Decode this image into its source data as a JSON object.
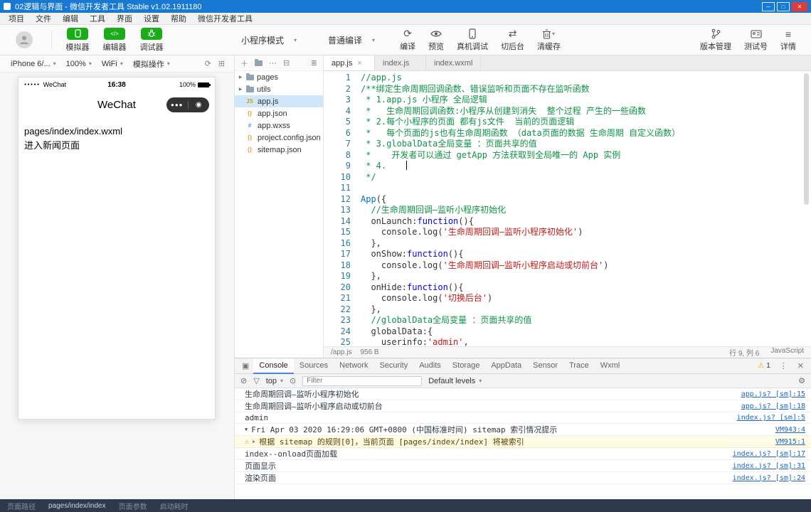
{
  "colors": {
    "title_blue": "#1879d2",
    "wechat_green": "#1aad19",
    "warning_bg": "#fffbe5",
    "link_blue": "#1a66c9",
    "comment_green": "#0e9347",
    "keyword_blue": "#0000ff",
    "string_red": "#c41a16"
  },
  "titlebar": {
    "title": "02逻辑与界面 - 微信开发者工具 Stable v1.02.1911180"
  },
  "menubar": {
    "items": [
      "项目",
      "文件",
      "编辑",
      "工具",
      "界面",
      "设置",
      "帮助",
      "微信开发者工具"
    ]
  },
  "toolbar": {
    "view_buttons": [
      {
        "label": "模拟器"
      },
      {
        "label": "编辑器"
      },
      {
        "label": "调试器"
      }
    ],
    "mode_select": {
      "value": "小程序模式"
    },
    "compile_select": {
      "value": "普通编译"
    },
    "actions": [
      {
        "label": "编译"
      },
      {
        "label": "预览"
      },
      {
        "label": "真机调试"
      },
      {
        "label": "切后台"
      },
      {
        "label": "清缓存"
      }
    ],
    "right_actions": [
      {
        "label": "版本管理"
      },
      {
        "label": "测试号"
      },
      {
        "label": "详情"
      }
    ]
  },
  "simulator": {
    "device_select": "iPhone 6/...",
    "zoom_select": "100%",
    "network_select": "WiFi",
    "operation_select": "模拟操作",
    "phone": {
      "carrier": "WeChat",
      "time": "16:38",
      "battery": "100%",
      "nav_title": "WeChat",
      "content": [
        "pages/index/index.wxml",
        "进入新闻页面"
      ]
    }
  },
  "explorer": {
    "files": [
      {
        "name": "pages",
        "kind": "folder"
      },
      {
        "name": "utils",
        "kind": "folder"
      },
      {
        "name": "app.js",
        "kind": "js",
        "selected": true
      },
      {
        "name": "app.json",
        "kind": "json"
      },
      {
        "name": "app.wxss",
        "kind": "wxss"
      },
      {
        "name": "project.config.json",
        "kind": "json"
      },
      {
        "name": "sitemap.json",
        "kind": "json"
      }
    ]
  },
  "editor": {
    "tabs": [
      {
        "label": "app.js",
        "active": true
      },
      {
        "label": "index.js",
        "active": false
      },
      {
        "label": "index.wxml",
        "active": false
      }
    ],
    "status": {
      "file": "/app.js",
      "size": "956 B",
      "cursor": "行 9, 列 6",
      "language": "JavaScript"
    },
    "code": [
      {
        "n": 1,
        "seg": [
          [
            "c",
            "//app.js"
          ]
        ]
      },
      {
        "n": 2,
        "seg": [
          [
            "c",
            "/**绑定生命周期回调函数、错误监听和页面不存在监听函数"
          ]
        ]
      },
      {
        "n": 3,
        "seg": [
          [
            "c",
            " * 1.app.js 小程序 全局逻辑"
          ]
        ]
      },
      {
        "n": 4,
        "seg": [
          [
            "c",
            " *   生命周期回调函数:小程序从创建到消失  整个过程 产生的一些函数"
          ]
        ]
      },
      {
        "n": 5,
        "seg": [
          [
            "c",
            " * 2.每个小程序的页面 都有js文件  当前的页面逻辑"
          ]
        ]
      },
      {
        "n": 6,
        "seg": [
          [
            "c",
            " *   每个页面的js也有生命周期函数 （data页面的数据 生命周期 自定义函数）"
          ]
        ]
      },
      {
        "n": 7,
        "seg": [
          [
            "c",
            " * 3.globalData全局变量 ：页面共享的值"
          ]
        ]
      },
      {
        "n": 8,
        "seg": [
          [
            "c",
            " *    开发者可以通过 getApp 方法获取到全局唯一的 App 实例"
          ]
        ]
      },
      {
        "n": 9,
        "seg": [
          [
            "c",
            " * 4."
          ]
        ],
        "cursor": true
      },
      {
        "n": 10,
        "seg": [
          [
            "c",
            " */"
          ]
        ]
      },
      {
        "n": 11,
        "seg": []
      },
      {
        "n": 12,
        "seg": [
          [
            "f",
            "App"
          ],
          [
            "p",
            "({"
          ]
        ]
      },
      {
        "n": 13,
        "seg": [
          [
            "c",
            "  //生命周期回调—监听小程序初始化"
          ]
        ]
      },
      {
        "n": 14,
        "seg": [
          [
            "p",
            "  onLaunch:"
          ],
          [
            "k",
            "function"
          ],
          [
            "p",
            "(){"
          ]
        ]
      },
      {
        "n": 15,
        "seg": [
          [
            "p",
            "    console.log("
          ],
          [
            "s",
            "'生命周期回调—监听小程序初始化'"
          ],
          [
            "p",
            ")"
          ]
        ]
      },
      {
        "n": 16,
        "seg": [
          [
            "p",
            "  },"
          ]
        ]
      },
      {
        "n": 17,
        "seg": [
          [
            "p",
            "  onShow:"
          ],
          [
            "k",
            "function"
          ],
          [
            "p",
            "(){"
          ]
        ]
      },
      {
        "n": 18,
        "seg": [
          [
            "p",
            "    console.log("
          ],
          [
            "s",
            "'生命周期回调—监听小程序启动或切前台'"
          ],
          [
            "p",
            ")"
          ]
        ]
      },
      {
        "n": 19,
        "seg": [
          [
            "p",
            "  },"
          ]
        ]
      },
      {
        "n": 20,
        "seg": [
          [
            "p",
            "  onHide:"
          ],
          [
            "k",
            "function"
          ],
          [
            "p",
            "(){"
          ]
        ]
      },
      {
        "n": 21,
        "seg": [
          [
            "p",
            "    console.log("
          ],
          [
            "s",
            "'切换后台'"
          ],
          [
            "p",
            ")"
          ]
        ]
      },
      {
        "n": 22,
        "seg": [
          [
            "p",
            "  },"
          ]
        ]
      },
      {
        "n": 23,
        "seg": [
          [
            "c",
            "  //globalData全局变量 ：页面共享的值"
          ]
        ]
      },
      {
        "n": 24,
        "seg": [
          [
            "p",
            "  globalData:{"
          ]
        ]
      },
      {
        "n": 25,
        "seg": [
          [
            "p",
            "    userinfo:"
          ],
          [
            "s",
            "'admin'"
          ],
          [
            "p",
            ","
          ]
        ]
      }
    ]
  },
  "devtools": {
    "tabs": [
      "Console",
      "Sources",
      "Network",
      "Security",
      "Audits",
      "Storage",
      "AppData",
      "Sensor",
      "Trace",
      "Wxml"
    ],
    "active_tab": "Console",
    "warning_count": "1",
    "context": "top",
    "filter_placeholder": "Filter",
    "levels": "Default levels",
    "messages": [
      {
        "type": "log",
        "text": "生命周期回调—监听小程序初始化",
        "source": "app.js? [sm]:15"
      },
      {
        "type": "log",
        "text": "生命周期回调—监听小程序启动或切前台",
        "source": "app.js? [sm]:18"
      },
      {
        "type": "log",
        "text": "admin",
        "source": "index.js? [sm]:5"
      },
      {
        "type": "group",
        "text": "Fri Apr 03 2020 16:29:06 GMT+0800 (中国标准时间) sitemap 索引情况提示",
        "source": "VM943:4"
      },
      {
        "type": "warning",
        "text": "根据 sitemap 的规则[0]，当前页面 [pages/index/index] 将被索引",
        "source": "VM915:1"
      },
      {
        "type": "log",
        "text": "index--onload页面加载",
        "source": "index.js? [sm]:17"
      },
      {
        "type": "log",
        "text": "页面显示",
        "source": "index.js? [sm]:31"
      },
      {
        "type": "log",
        "text": "渲染页面",
        "source": "index.js? [sm]:24"
      }
    ]
  },
  "statusbar": {
    "items": [
      "页面路径",
      "pages/index/index",
      "页面参数",
      "启动耗时"
    ]
  }
}
